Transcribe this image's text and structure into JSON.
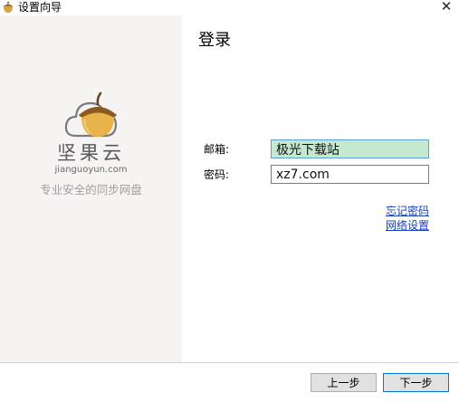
{
  "window": {
    "title": "设置向导",
    "close_glyph": "✕"
  },
  "brand": {
    "name": "坚果云",
    "domain": "jianguoyun.com",
    "slogan": "专业安全的同步网盘",
    "icon": "acorn-cloud-logo"
  },
  "login": {
    "heading": "登录",
    "email_label": "邮箱:",
    "email_value": "极光下载站",
    "password_label": "密码:",
    "password_value": "xz7.com",
    "forgot_password_link": "忘记密码",
    "network_settings_link": "网络设置"
  },
  "footer": {
    "prev_label": "上一步",
    "next_label": "下一步"
  },
  "colors": {
    "accent": "#0078d7",
    "link": "#1a40b8",
    "email_field_bg": "#c5e9d0",
    "left_panel_bg": "#f6f3f3"
  }
}
